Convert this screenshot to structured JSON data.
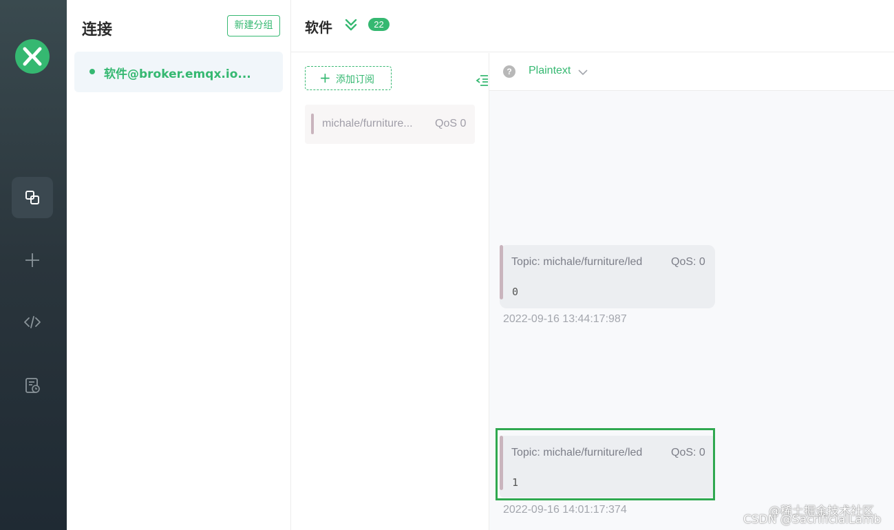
{
  "colors": {
    "accent": "#35b871",
    "rail_bg": "#2a353c",
    "highlight_border": "#2fa84f"
  },
  "rail": {
    "logo_icon": "mqttx-logo-icon",
    "items": [
      {
        "name": "connections-icon",
        "active": true
      },
      {
        "name": "plus-icon",
        "active": false
      },
      {
        "name": "code-icon",
        "active": false
      },
      {
        "name": "log-icon",
        "active": false
      }
    ]
  },
  "connections": {
    "title": "连接",
    "new_group_label": "新建分组",
    "items": [
      {
        "name": "软件@broker.emqx.io...",
        "status": "connected"
      }
    ]
  },
  "header": {
    "title": "软件",
    "count": "22"
  },
  "subscriptions": {
    "add_label": "添加订阅",
    "items": [
      {
        "topic": "michale/furniture...",
        "qos": "QoS 0"
      }
    ]
  },
  "messages_toolbar": {
    "help": "?",
    "format": "Plaintext"
  },
  "messages": [
    {
      "topic": "Topic: michale/furniture/led",
      "qos": "QoS: 0",
      "payload": "0",
      "time": "2022-09-16 13:44:17:987"
    },
    {
      "topic": "Topic: michale/furniture/led",
      "qos": "QoS: 0",
      "payload": "1",
      "time": "2022-09-16 14:01:17:374"
    }
  ],
  "watermark": {
    "line1": "@稀土掘金技术社区",
    "line2": "CSDN @SacrificialLamb"
  }
}
